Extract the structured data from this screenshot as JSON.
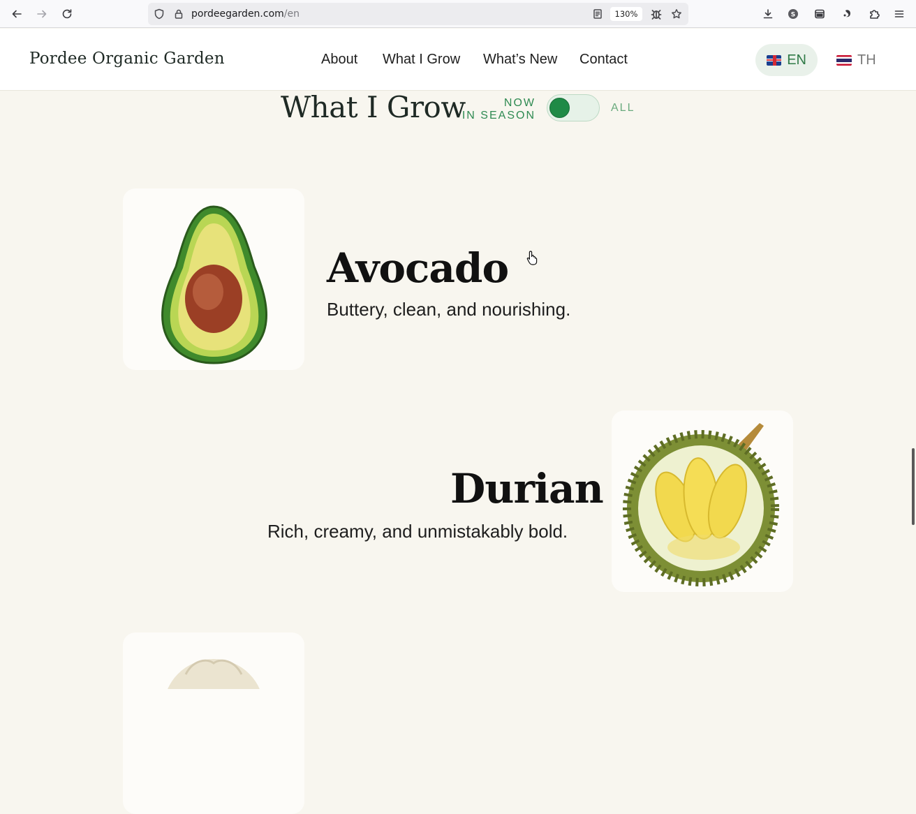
{
  "browser": {
    "url_domain": "pordeegarden.com",
    "url_path": "/en",
    "zoom": "130%",
    "icons": [
      "back-icon",
      "forward-icon",
      "reload-icon",
      "shield-icon",
      "lock-icon",
      "reader-view-icon",
      "bug-icon",
      "bookmark-star-icon",
      "download-icon",
      "account-icon",
      "sidebar-icon",
      "extension-icon",
      "puzzle-icon",
      "menu-icon"
    ]
  },
  "site": {
    "brand": "Pordee Organic Garden",
    "nav": [
      "About",
      "What I Grow",
      "What’s New",
      "Contact"
    ],
    "lang_active": "EN",
    "lang_other": "TH"
  },
  "section": {
    "title": "What I Grow",
    "season_line1": "NOW",
    "season_line2": "IN SEASON",
    "all_label": "ALL",
    "toggle_on": true
  },
  "produce": [
    {
      "name": "Avocado",
      "description": "Buttery, clean, and nourishing.",
      "image": "avocado-image"
    },
    {
      "name": "Durian",
      "description": "Rich, creamy, and unmistakably bold.",
      "image": "durian-image"
    },
    {
      "name": "",
      "description": "",
      "image": "longan-image"
    }
  ],
  "colors": {
    "page_bg": "#f8f6ef",
    "accent_green": "#2f8a52",
    "toggle_knob": "#1f8a46",
    "lang_active_bg": "#e9f1ea"
  }
}
